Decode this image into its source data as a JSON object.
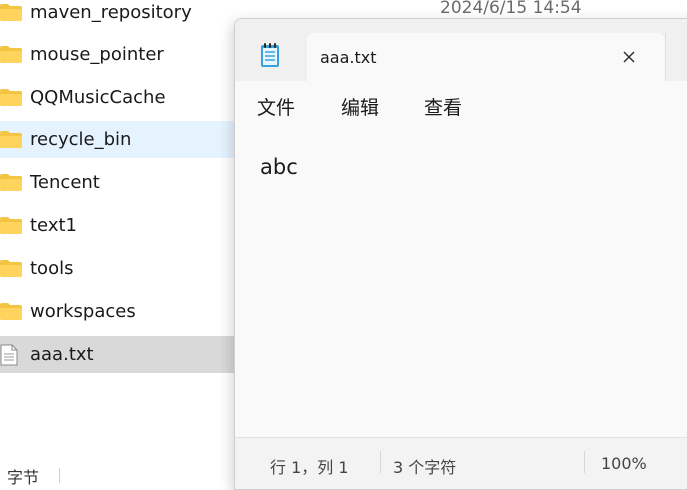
{
  "explorer": {
    "top_date": "2024/6/15 14:54",
    "files": [
      {
        "name": "maven_repository",
        "type": "folder"
      },
      {
        "name": "mouse_pointer",
        "type": "folder"
      },
      {
        "name": "QQMusicCache",
        "type": "folder"
      },
      {
        "name": "recycle_bin",
        "type": "folder",
        "state": "hover"
      },
      {
        "name": "Tencent",
        "type": "folder"
      },
      {
        "name": "text1",
        "type": "folder"
      },
      {
        "name": "tools",
        "type": "folder"
      },
      {
        "name": "workspaces",
        "type": "folder"
      },
      {
        "name": "aaa.txt",
        "type": "text-file",
        "state": "selected"
      }
    ],
    "status_left": "字节",
    "colors": {
      "folder": "#f4c542",
      "hover": "#e5f3ff",
      "selected": "#d9d9d9"
    }
  },
  "notepad": {
    "tab_title": "aaa.txt",
    "icon": "notepad-icon",
    "close_icon": "close-icon",
    "menu": {
      "file": "文件",
      "edit": "编辑",
      "view": "查看"
    },
    "content": "abc",
    "status": {
      "position": "行 1，列 1",
      "char_count": "3 个字符",
      "zoom": "100%"
    }
  }
}
